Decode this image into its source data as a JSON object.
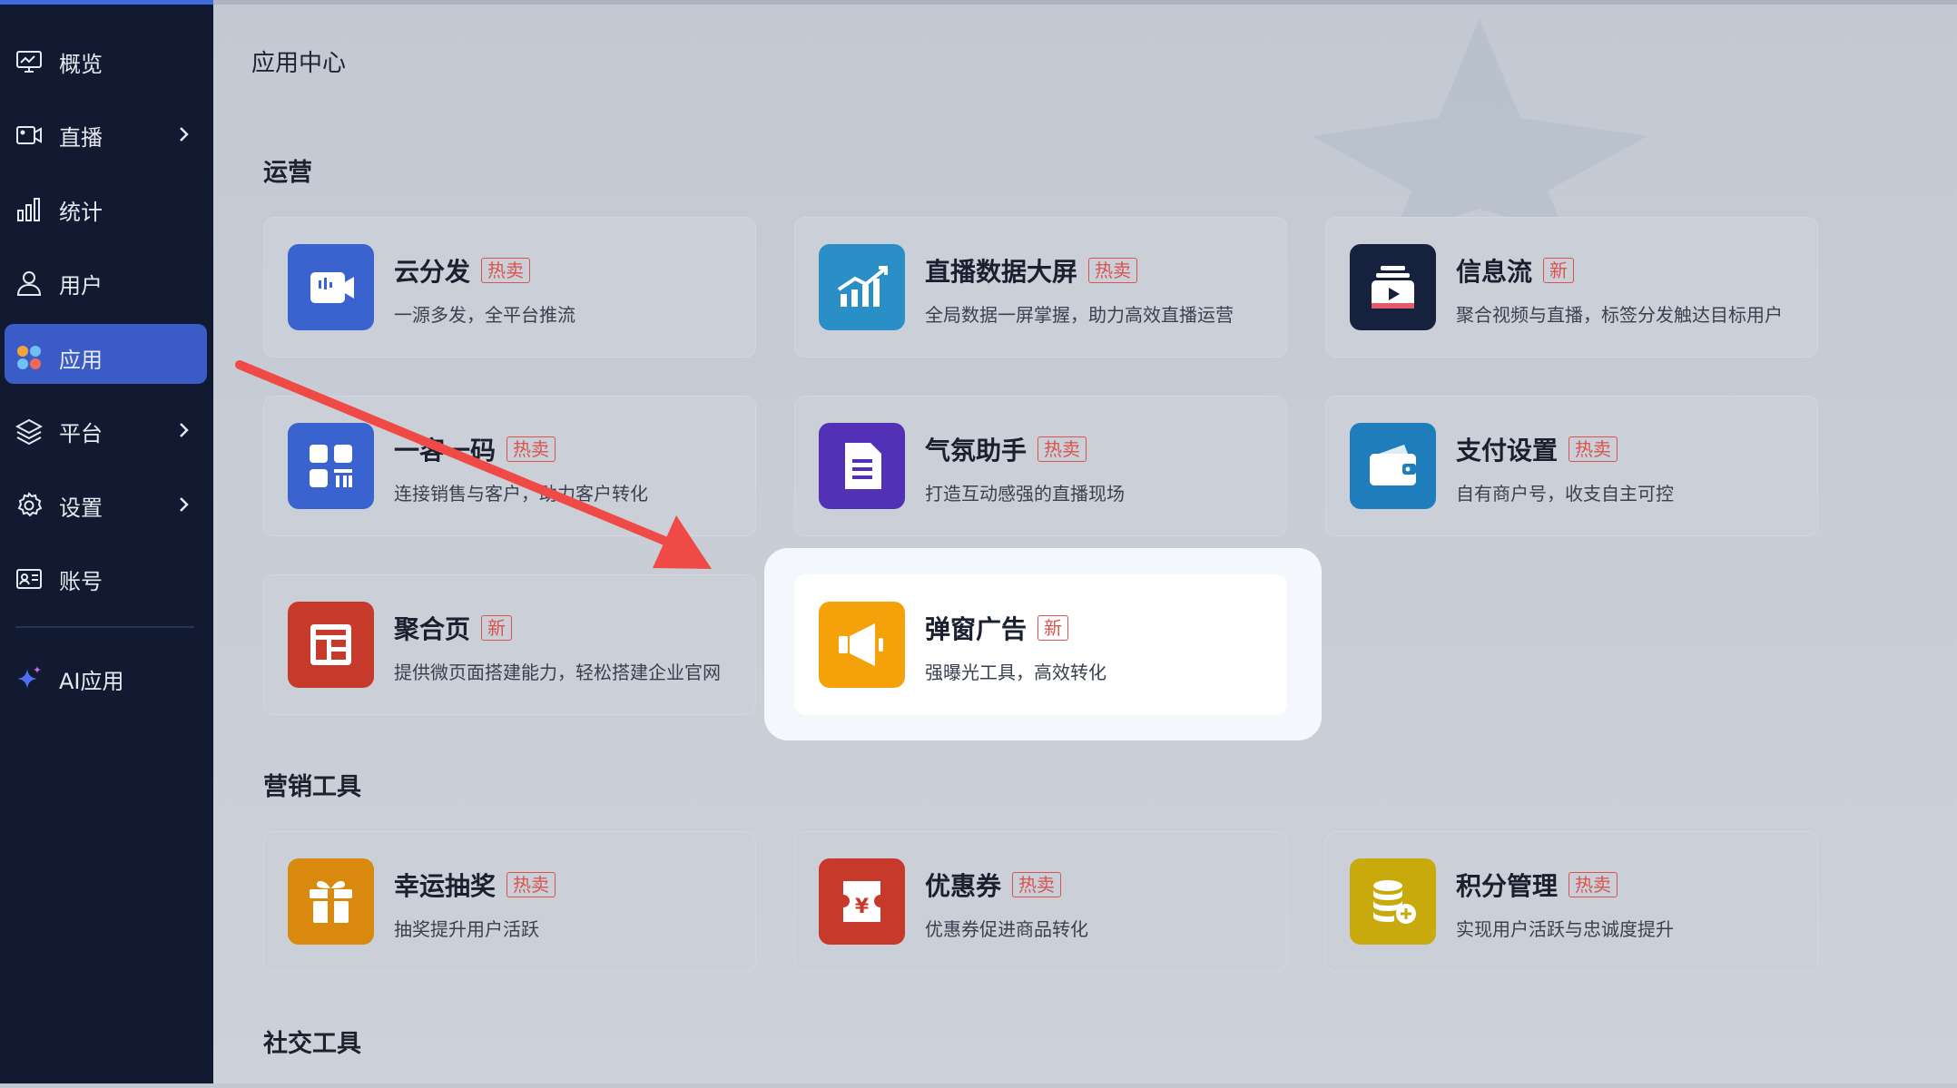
{
  "sidebar": {
    "items": [
      {
        "label": "概览",
        "icon": "monitor-icon"
      },
      {
        "label": "直播",
        "icon": "video-camera-icon",
        "has_submenu": true
      },
      {
        "label": "统计",
        "icon": "bar-chart-icon"
      },
      {
        "label": "用户",
        "icon": "user-icon"
      },
      {
        "label": "应用",
        "icon": "apps-icon",
        "active": true
      },
      {
        "label": "平台",
        "icon": "layers-icon",
        "has_submenu": true
      },
      {
        "label": "设置",
        "icon": "gear-icon",
        "has_submenu": true
      },
      {
        "label": "账号",
        "icon": "id-card-icon"
      },
      {
        "label": "AI应用",
        "icon": "sparkle-icon"
      }
    ]
  },
  "page": {
    "title": "应用中心"
  },
  "sections": [
    {
      "title": "运营",
      "cards": [
        {
          "name": "云分发",
          "badge": "热卖",
          "desc": "一源多发，全平台推流",
          "icon": "video-icon",
          "color": "#3a63cf"
        },
        {
          "name": "直播数据大屏",
          "badge": "热卖",
          "desc": "全局数据一屏掌握，助力高效直播运营",
          "icon": "growth-chart-icon",
          "color": "#2a8fc7"
        },
        {
          "name": "信息流",
          "badge": "新",
          "desc": "聚合视频与直播，标签分发触达目标用户",
          "icon": "play-stack-icon",
          "color": "#16213d"
        },
        {
          "name": "一客一码",
          "badge": "热卖",
          "desc": "连接销售与客户，助力客户转化",
          "icon": "qr-grid-icon",
          "color": "#3a63cf"
        },
        {
          "name": "气氛助手",
          "badge": "热卖",
          "desc": "打造互动感强的直播现场",
          "icon": "document-icon",
          "color": "#5231b6"
        },
        {
          "name": "支付设置",
          "badge": "热卖",
          "desc": "自有商户号，收支自主可控",
          "icon": "wallet-icon",
          "color": "#1f7dbc"
        },
        {
          "name": "聚合页",
          "badge": "新",
          "desc": "提供微页面搭建能力，轻松搭建企业官网",
          "icon": "layout-icon",
          "color": "#c7392b"
        },
        {
          "name": "弹窗广告",
          "badge": "新",
          "desc": "强曝光工具，高效转化",
          "icon": "megaphone-icon",
          "color": "#f5a10a",
          "highlighted": true
        }
      ]
    },
    {
      "title": "营销工具",
      "cards": [
        {
          "name": "幸运抽奖",
          "badge": "热卖",
          "desc": "抽奖提升用户活跃",
          "icon": "gift-icon",
          "color": "#d98a0e"
        },
        {
          "name": "优惠券",
          "badge": "热卖",
          "desc": "优惠券促进商品转化",
          "icon": "coupon-icon",
          "color": "#c7392b"
        },
        {
          "name": "积分管理",
          "badge": "热卖",
          "desc": "实现用户活跃与忠诚度提升",
          "icon": "coins-icon",
          "color": "#c9aa0c"
        }
      ]
    },
    {
      "title": "社交工具",
      "cards": []
    }
  ],
  "colors": {
    "sidebar_bg": "#111a31",
    "active_item": "#3b5cc6",
    "badge": "#d9534f",
    "arrow": "#ef4a45"
  }
}
